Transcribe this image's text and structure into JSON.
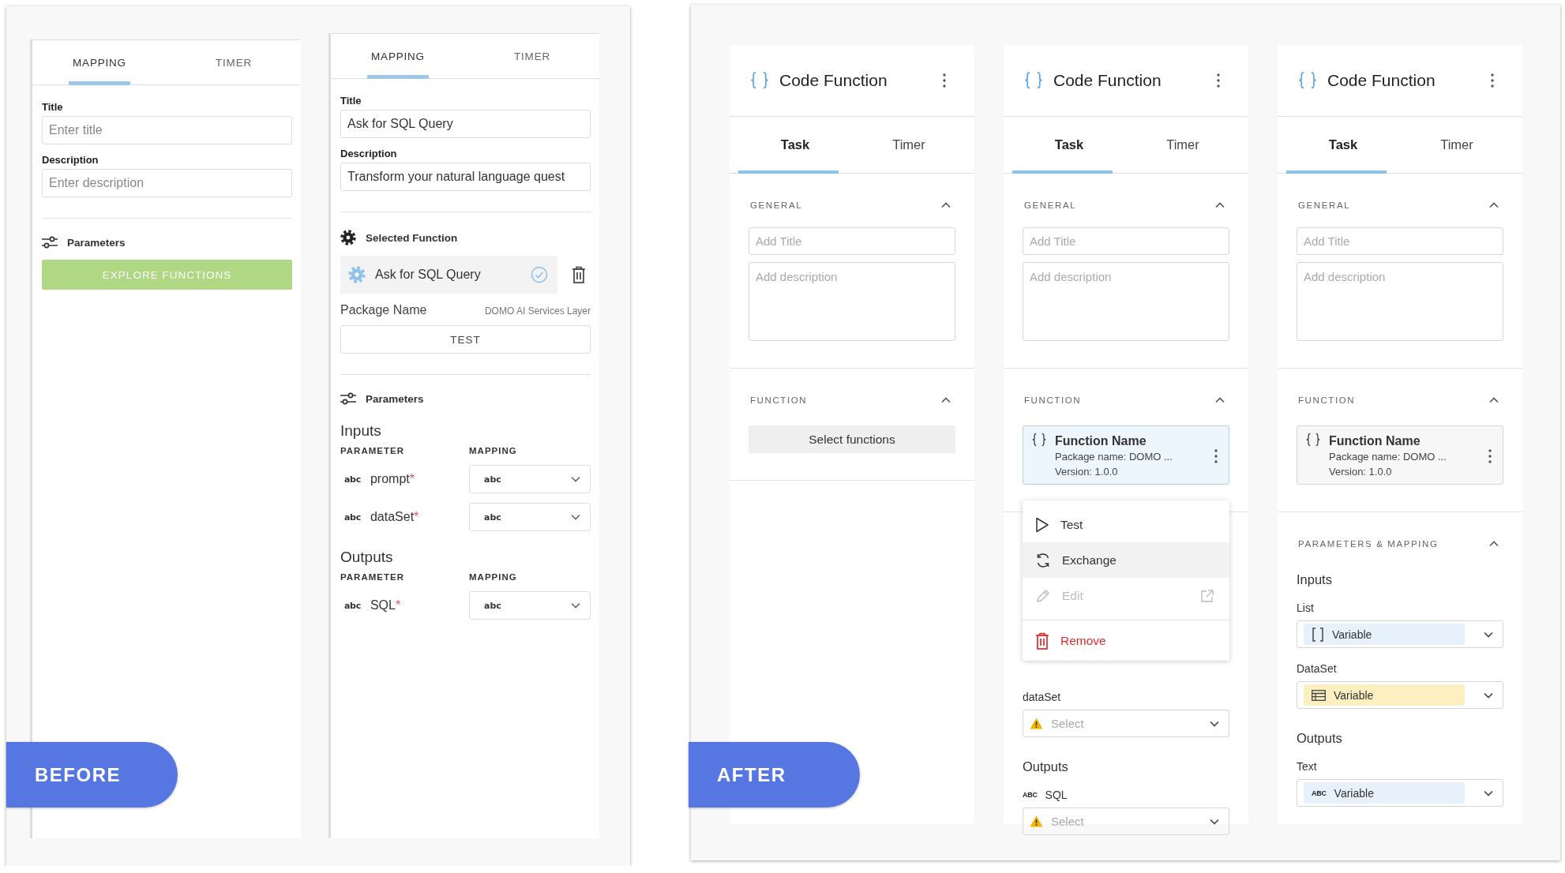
{
  "before": {
    "label": "BEFORE",
    "panels": [
      {
        "tabs": [
          {
            "label": "MAPPING",
            "selected": true
          },
          {
            "label": "TIMER",
            "selected": false
          }
        ],
        "title_label": "Title",
        "title_field": {
          "placeholder": "Enter title"
        },
        "description_label": "Description",
        "description_field": {
          "placeholder": "Enter description"
        },
        "parameters_heading": "Parameters",
        "explore_button": "EXPLORE FUNCTIONS"
      },
      {
        "tabs": [
          {
            "label": "MAPPING",
            "selected": true
          },
          {
            "label": "TIMER",
            "selected": false
          }
        ],
        "title_label": "Title",
        "title_field": {
          "value": "Ask for SQL Query"
        },
        "description_label": "Description",
        "description_field": {
          "value": "Transform your natural language quest"
        },
        "selected_function": {
          "heading": "Selected Function",
          "name": "Ask for SQL Query",
          "package_label": "Package Name",
          "package_value": "DOMO AI Services Layer",
          "test_button": "TEST"
        },
        "parameters_heading": "Parameters",
        "groups": [
          {
            "heading": "Inputs",
            "columns": [
              "PARAMETER",
              "MAPPING"
            ],
            "rows": [
              {
                "type_label": "abc",
                "name": "prompt",
                "required_mark": "*",
                "mapping": "abc"
              },
              {
                "type_label": "abc",
                "name": "dataSet",
                "required_mark": "*",
                "mapping": "abc"
              }
            ]
          },
          {
            "heading": "Outputs",
            "columns": [
              "PARAMETER",
              "MAPPING"
            ],
            "rows": [
              {
                "type_label": "abc",
                "name": "SQL",
                "required_mark": "*",
                "mapping": "abc"
              }
            ]
          }
        ]
      }
    ]
  },
  "after": {
    "label": "AFTER",
    "cards": [
      {
        "title": "Code Function",
        "tabs": [
          {
            "label": "Task",
            "selected": true
          },
          {
            "label": "Timer",
            "selected": false
          }
        ],
        "general": {
          "heading": "GENERAL",
          "expanded": true,
          "title_field": {
            "placeholder": "Add Title"
          },
          "description_field": {
            "placeholder": "Add description"
          }
        },
        "function": {
          "heading": "FUNCTION",
          "expanded": true,
          "select_button": "Select functions"
        }
      },
      {
        "title": "Code Function",
        "tabs": [
          {
            "label": "Task",
            "selected": true
          },
          {
            "label": "Timer",
            "selected": false
          }
        ],
        "general": {
          "heading": "GENERAL",
          "expanded": true,
          "title_field": {
            "placeholder": "Add Title"
          },
          "description_field": {
            "placeholder": "Add description"
          }
        },
        "function": {
          "heading": "FUNCTION",
          "expanded": true,
          "selected_function": {
            "name": "Function Name",
            "package": "Package name: DOMO ...",
            "version": "Version: 1.0.0",
            "active": true
          },
          "menu": {
            "items": [
              {
                "kind": "test",
                "label": "Test",
                "hovered": false,
                "disabled": false
              },
              {
                "kind": "exchange",
                "label": "Exchange",
                "hovered": true,
                "disabled": false
              },
              {
                "kind": "edit",
                "label": "Edit",
                "hovered": false,
                "disabled": true
              },
              {
                "kind": "remove",
                "label": "Remove",
                "hovered": false,
                "disabled": false
              }
            ]
          }
        },
        "parameters": {
          "inputs": [
            {
              "name": "dataSet",
              "select": {
                "placeholder": "Select",
                "warning": true
              }
            }
          ],
          "outputs_heading": "Outputs",
          "outputs": [
            {
              "type_label": "ABC",
              "name": "SQL",
              "select": {
                "placeholder": "Select",
                "warning": true
              }
            }
          ]
        }
      },
      {
        "title": "Code Function",
        "tabs": [
          {
            "label": "Task",
            "selected": true
          },
          {
            "label": "Timer",
            "selected": false
          }
        ],
        "general": {
          "heading": "GENERAL",
          "expanded": true,
          "title_field": {
            "placeholder": "Add Title"
          },
          "description_field": {
            "placeholder": "Add description"
          }
        },
        "function": {
          "heading": "FUNCTION",
          "expanded": true,
          "selected_function": {
            "name": "Function Name",
            "package": "Package name: DOMO ...",
            "version": "Version: 1.0.0",
            "active": false
          }
        },
        "parameters": {
          "heading": "PARAMETERS & MAPPING",
          "expanded": true,
          "inputs_heading": "Inputs",
          "inputs": [
            {
              "name": "List",
              "select": {
                "variable": {
                  "kind": "list",
                  "label": "Variable",
                  "color": "#e6f1fc"
                }
              }
            },
            {
              "name": "DataSet",
              "select": {
                "variable": {
                  "kind": "dataset",
                  "label": "Variable",
                  "color": "#fdf0c0"
                }
              }
            }
          ],
          "outputs_heading": "Outputs",
          "outputs": [
            {
              "name": "Text",
              "select": {
                "variable": {
                  "kind": "text",
                  "icon_text": "ABC",
                  "label": "Variable",
                  "color": "#e6f1fc"
                }
              }
            }
          ]
        }
      }
    ]
  }
}
